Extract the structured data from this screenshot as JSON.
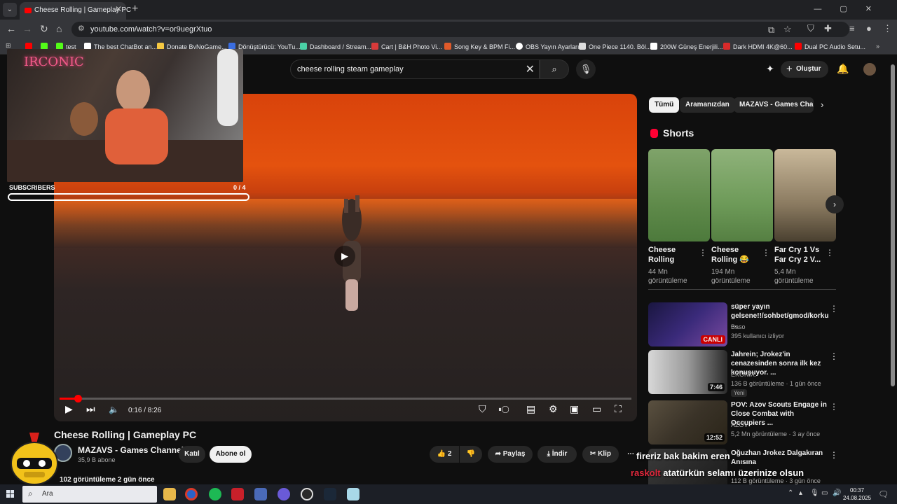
{
  "browser": {
    "tab_title": "Cheese Rolling | Gameplay PC",
    "url": "youtube.com/watch?v=or9uegrXtuo",
    "bookmarks": [
      "test",
      "The best ChatBot an...",
      "Donate ByNoGame...",
      "Dönüştürücü: YouTu...",
      "Dashboard / Stream...",
      "Cart | B&H Photo Vi...",
      "Song Key & BPM Fi...",
      "OBS Yayın Ayarları",
      "One Piece 1140. Böl...",
      "200W Güneş Enerjili...",
      "Dark HDMI 4K@60...",
      "Dual PC Audio Setu..."
    ]
  },
  "header": {
    "search_query": "cheese rolling steam gameplay",
    "create_label": "Oluştur"
  },
  "player": {
    "current_time": "0:16",
    "duration": "8:26",
    "time_display": "0:16 / 8:26",
    "progress_fraction": 0.032
  },
  "video": {
    "title": "Cheese Rolling | Gameplay PC",
    "channel": "MAZAVS - Games Channel",
    "subscribers": "35,9 B abone",
    "join_label": "Katıl",
    "subscribe_label": "Abone ol",
    "likes": "2",
    "share_label": "Paylaş",
    "download_label": "İndir",
    "clip_label": "Klip",
    "views_line": "102 görüntüleme  2 gün önce"
  },
  "filters": [
    "Tümü",
    "Aramanızdan",
    "MAZAVS - Games Chann"
  ],
  "shorts": {
    "heading": "Shorts",
    "items": [
      {
        "title": "Cheese Rolling",
        "views": "44 Mn görüntüleme"
      },
      {
        "title": "Cheese Rolling 😂",
        "views": "194 Mn görüntüleme"
      },
      {
        "title": "Far Cry 1 Vs Far Cry 2 V...",
        "views": "5,4 Mn görüntüleme"
      }
    ]
  },
  "recommendations": [
    {
      "title": "süper yayın gelsene!!/sohbet/gmod/korku ...",
      "channel": "Baso",
      "meta": "395 kullanıcı izliyor",
      "badge": "CANLI"
    },
    {
      "title": "Jahrein; Jrokez'in cenazesinden sonra ilk kez konuşuyor. ...",
      "channel": "EKONIX.",
      "meta": "136 B görüntüleme · 1 gün önce",
      "duration": "7:46",
      "tag": "Yeni"
    },
    {
      "title": "POV: Azov Scouts Engage in Close Combat with Occupiers ...",
      "channel": "AZOV",
      "meta": "5,2 Mn görüntüleme · 3 ay önce",
      "duration": "12:52"
    },
    {
      "title": "Oğuzhan Jrokez Dalgakıran Anısına",
      "channel": "",
      "meta": "112 B görüntüleme · 3 gün önce"
    }
  ],
  "overlay": {
    "subscribers_label": "SUBSCRIBERS",
    "subscribers_count": "0  / 4",
    "goal_fraction": 0,
    "neon_sign": "IRCONIC",
    "chat_line_1": "fireriz  bak bakim eren",
    "chat_line_2_user": "raskolt",
    "chat_line_2_text": "atatürkün selamı üzerinize olsun"
  },
  "taskbar": {
    "search_label": "Ara",
    "time": "00:37",
    "date": "24.08.2025"
  },
  "colors": {
    "accent": "#ff0000",
    "background": "#0f0f0f",
    "chip_bg": "#272727"
  }
}
